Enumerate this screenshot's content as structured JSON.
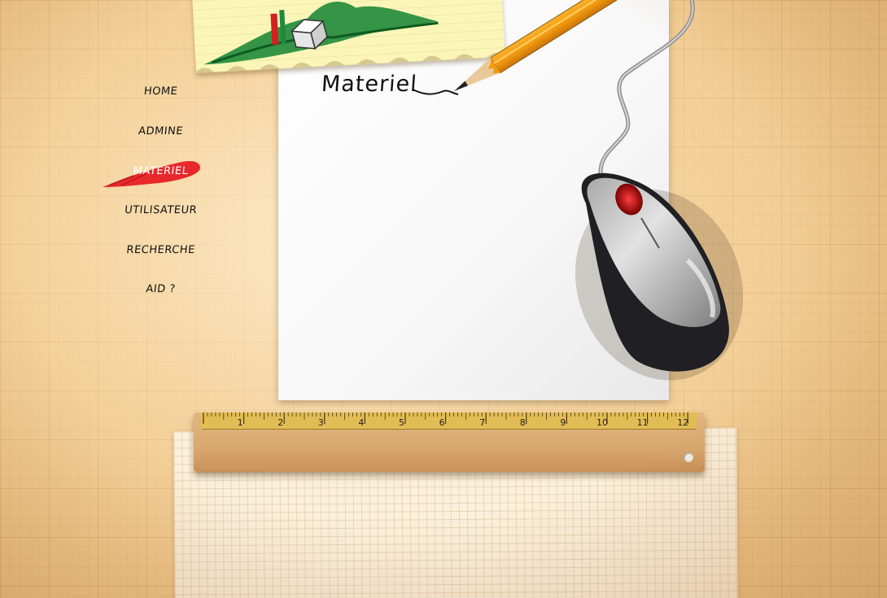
{
  "page": {
    "title": "Materiel"
  },
  "nav": {
    "items": [
      {
        "label": "HOME"
      },
      {
        "label": "ADMINE"
      },
      {
        "label": "MATERIEL",
        "active": true
      },
      {
        "label": "UTILISATEUR"
      },
      {
        "label": "RECHERCHE"
      },
      {
        "label": "AID ?"
      }
    ]
  },
  "ruler": {
    "numbers": [
      "1",
      "2",
      "3",
      "4",
      "5",
      "6",
      "7",
      "8",
      "9",
      "10",
      "11",
      "12"
    ]
  },
  "icons": {
    "logo": "logo-icon",
    "pencil": "pencil-icon",
    "mouse": "computer-mouse-icon",
    "brush": "brush-highlight-icon"
  },
  "colors": {
    "background": "#f0c88c",
    "active_highlight": "#e8282b",
    "logo_green": "#1f8a3a"
  }
}
